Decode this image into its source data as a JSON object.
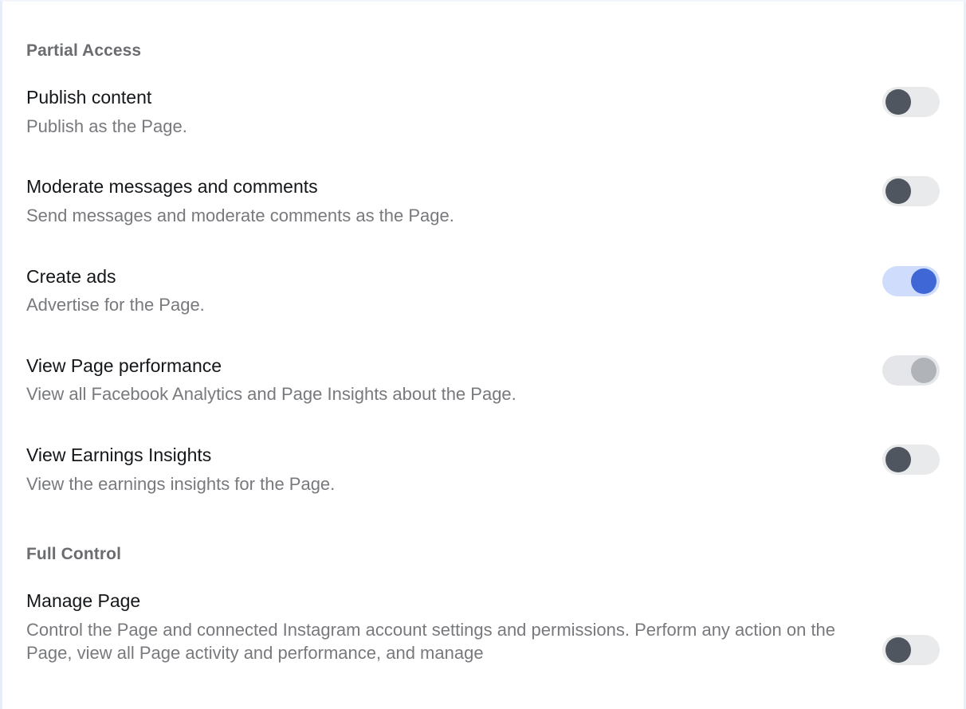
{
  "panel": {
    "sections": [
      {
        "id": "partial-access",
        "header": "Partial Access",
        "items": [
          {
            "id": "publish-content",
            "title": "Publish content",
            "description": "Publish as the Page.",
            "toggle": {
              "state": "off",
              "style": "default"
            }
          },
          {
            "id": "moderate-messages-and-comments",
            "title": "Moderate messages and comments",
            "description": "Send messages and moderate comments as the Page.",
            "toggle": {
              "state": "off",
              "style": "default"
            }
          },
          {
            "id": "create-ads",
            "title": "Create ads",
            "description": "Advertise for the Page.",
            "toggle": {
              "state": "on",
              "style": "blue"
            }
          },
          {
            "id": "view-page-performance",
            "title": "View Page performance",
            "description": "View all Facebook Analytics and Page Insights about the Page.",
            "toggle": {
              "state": "on",
              "style": "gray"
            }
          },
          {
            "id": "view-earnings-insights",
            "title": "View Earnings Insights",
            "description": "View the earnings insights for the Page.",
            "toggle": {
              "state": "off",
              "style": "default"
            }
          }
        ]
      },
      {
        "id": "full-control",
        "header": "Full Control",
        "items": [
          {
            "id": "manage-page",
            "title": "Manage Page",
            "description": "Control the Page and connected Instagram account settings and permissions. Perform any action on the Page, view all Page activity and performance, and manage",
            "toggle": {
              "state": "off",
              "style": "default"
            }
          }
        ]
      }
    ]
  },
  "colors": {
    "page_background": "#ffffff",
    "border": "#e7eef8",
    "section_header_text": "#6a6c70",
    "item_title_text": "#14171a",
    "item_description_text": "#77797d",
    "toggle_track_off": "#e9eaec",
    "toggle_knob_off": "#50565f",
    "toggle_track_on_blue": "#cfdcfb",
    "toggle_knob_on_blue": "#3f68d6",
    "toggle_track_on_gray": "#e4e6e9",
    "toggle_knob_on_gray": "#b0b3b8"
  }
}
